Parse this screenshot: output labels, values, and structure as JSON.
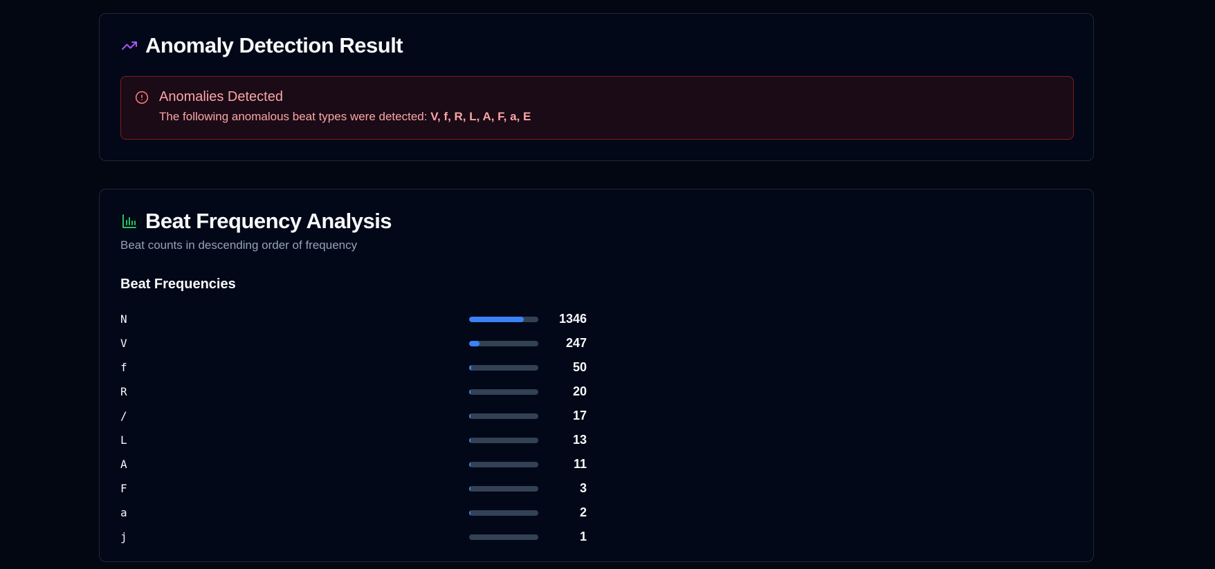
{
  "anomaly_card": {
    "title": "Anomaly Detection Result",
    "icon": "trending-up-icon",
    "alert": {
      "icon": "alert-circle-icon",
      "title": "Anomalies Detected",
      "description_prefix": "The following anomalous beat types were detected: ",
      "types": "V, f, R, L, A, F, a, E"
    }
  },
  "frequency_card": {
    "title": "Beat Frequency Analysis",
    "icon": "bar-chart-icon",
    "subtitle": "Beat counts in descending order of frequency",
    "section_title": "Beat Frequencies",
    "max_value": 1700,
    "items": [
      {
        "label": "N",
        "count": "1346",
        "value": 1346
      },
      {
        "label": "V",
        "count": "247",
        "value": 247
      },
      {
        "label": "f",
        "count": "50",
        "value": 50
      },
      {
        "label": "R",
        "count": "20",
        "value": 20
      },
      {
        "label": "/",
        "count": "17",
        "value": 17
      },
      {
        "label": "L",
        "count": "13",
        "value": 13
      },
      {
        "label": "A",
        "count": "11",
        "value": 11
      },
      {
        "label": "F",
        "count": "3",
        "value": 3
      },
      {
        "label": "a",
        "count": "2",
        "value": 2
      },
      {
        "label": "j",
        "count": "1",
        "value": 1
      }
    ]
  },
  "colors": {
    "accent_purple": "#a855f7",
    "accent_green": "#22c55e",
    "bar_fill": "#3b82f6",
    "alert_text": "#fca5a5"
  }
}
